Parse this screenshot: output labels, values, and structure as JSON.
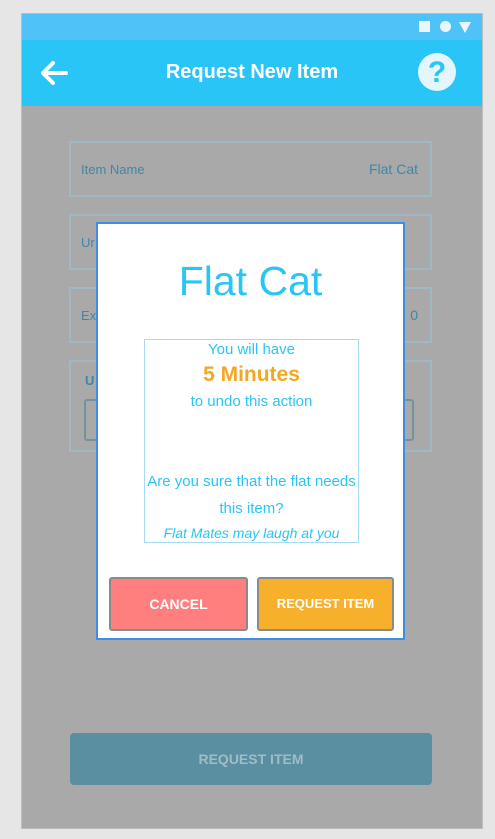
{
  "status_bar": {
    "icons": [
      "square-icon",
      "circle-icon",
      "triangle-icon"
    ]
  },
  "app_bar": {
    "title": "Request New Item",
    "back_icon": "arrow-left-icon",
    "help_icon": "question-mark-icon",
    "help_glyph": "?"
  },
  "form": {
    "item_name_label": "Item Name",
    "item_name_value": "Flat Cat",
    "field2_partial_label": "Ur",
    "field3_partial_label": "Ex",
    "field3_partial_value": "0",
    "field4_partial_label": "U",
    "submit_label": "REQUEST ITEM"
  },
  "dialog": {
    "title": "Flat Cat",
    "line1": "You will have",
    "minutes": "5 Minutes",
    "line3": "to undo this action",
    "question_line1": "Are you sure that the flat needs",
    "question_line2": "this item?",
    "warning": "Flat Mates may laugh at you",
    "cancel_label": "CANCEL",
    "confirm_label": "REQUEST ITEM"
  },
  "colors": {
    "app_bar": "#29c5f6",
    "accent_orange": "#f7b02b",
    "cancel_red": "#ff7f7f",
    "dialog_border": "#3d8ee6"
  }
}
